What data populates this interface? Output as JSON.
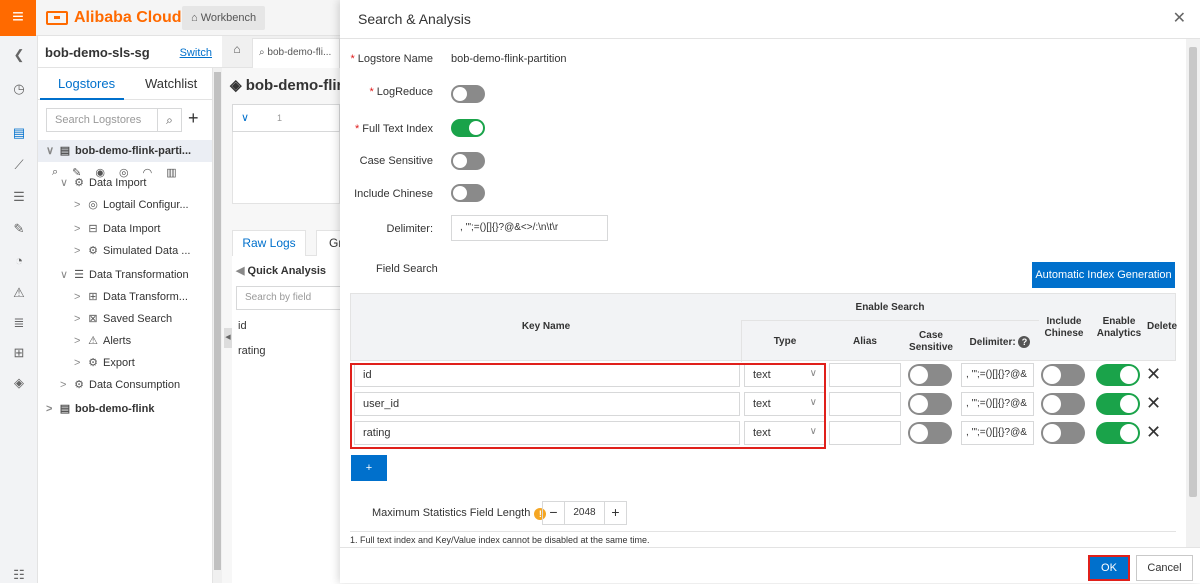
{
  "topbar": {
    "brand": "Alibaba Cloud",
    "workbench": "Workbench"
  },
  "project": {
    "name": "bob-demo-sls-sg",
    "switch_label": "Switch"
  },
  "sidebar": {
    "tabs": [
      "Logstores",
      "Watchlist"
    ],
    "search_placeholder": "Search Logstores",
    "tree": [
      {
        "label": "bob-demo-flink-parti...",
        "level": 0,
        "arrow": "∨",
        "icon": "▤",
        "selected": true
      },
      {
        "label": "Data Import",
        "level": 1,
        "arrow": "∨",
        "icon": "⚙"
      },
      {
        "label": "Logtail Configur...",
        "level": 2,
        "arrow": ">",
        "icon": "◎"
      },
      {
        "label": "Data Import",
        "level": 2,
        "arrow": ">",
        "icon": "⊟"
      },
      {
        "label": "Simulated Data ...",
        "level": 2,
        "arrow": ">",
        "icon": "⚙"
      },
      {
        "label": "Data Transformation",
        "level": 1,
        "arrow": "∨",
        "icon": "☰"
      },
      {
        "label": "Data Transform...",
        "level": 2,
        "arrow": ">",
        "icon": "⊞"
      },
      {
        "label": "Saved Search",
        "level": 2,
        "arrow": ">",
        "icon": "⊠"
      },
      {
        "label": "Alerts",
        "level": 2,
        "arrow": ">",
        "icon": "⚠"
      },
      {
        "label": "Export",
        "level": 2,
        "arrow": ">",
        "icon": "⚙"
      },
      {
        "label": "Data Consumption",
        "level": 1,
        "arrow": ">",
        "icon": "⚙"
      },
      {
        "label": "bob-demo-flink",
        "level": 0,
        "arrow": ">",
        "icon": "▤",
        "bold": true
      }
    ]
  },
  "main": {
    "tab_label": "bob-demo-fli...",
    "logstore_title": "bob-demo-flin",
    "line_number": "1",
    "result_tabs": [
      "Raw Logs",
      "Grap"
    ],
    "quick_analysis": "Quick Analysis",
    "field_search_placeholder": "Search by field",
    "fields": [
      "id",
      "rating"
    ]
  },
  "dialog": {
    "title": "Search & Analysis",
    "logstore_name_label": "Logstore Name",
    "logstore_name": "bob-demo-flink-partition",
    "logreduce_label": "LogReduce",
    "logreduce": false,
    "full_text_label": "Full Text Index",
    "full_text": true,
    "case_sensitive_label": "Case Sensitive",
    "case_sensitive": false,
    "include_chinese_label": "Include Chinese",
    "include_chinese": false,
    "delimiter_label": "Delimiter:",
    "delimiter": ", '\";=()[]{}?@&<>/:\\n\\t\\r",
    "field_search_title": "Field Search",
    "auto_index_label": "Automatic Index Generation",
    "table": {
      "key_name": "Key Name",
      "enable_search": "Enable Search",
      "type": "Type",
      "alias": "Alias",
      "case_sensitive": "Case Sensitive",
      "delimiter": "Delimiter:",
      "include_chinese": "Include Chinese",
      "enable_analytics": "Enable Analytics",
      "delete": "Delete"
    },
    "rows": [
      {
        "key": "id",
        "type": "text",
        "alias": "",
        "case_sensitive": false,
        "delimiter": ", '\";=()[]{}?@&",
        "include_chinese": false,
        "analytics": true
      },
      {
        "key": "user_id",
        "type": "text",
        "alias": "",
        "case_sensitive": false,
        "delimiter": ", '\";=()[]{}?@&",
        "include_chinese": false,
        "analytics": true
      },
      {
        "key": "rating",
        "type": "text",
        "alias": "",
        "case_sensitive": false,
        "delimiter": ", '\";=()[]{}?@&",
        "include_chinese": false,
        "analytics": true
      }
    ],
    "add_label": "+",
    "max_stat_label": "Maximum Statistics Field Length",
    "max_stat_value": "2048",
    "note": "1. Full text index and Key/Value index cannot be disabled at the same time.",
    "ok_label": "OK",
    "cancel_label": "Cancel"
  },
  "colors": {
    "brand": "#ff6a00",
    "primary": "#0070cc",
    "toggle_on": "#1aa34a",
    "highlight": "#e0201b"
  }
}
